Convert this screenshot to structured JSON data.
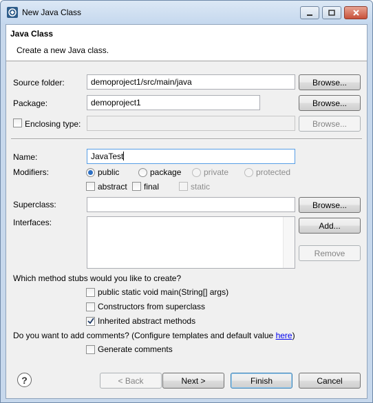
{
  "window": {
    "title": "New Java Class"
  },
  "banner": {
    "title": "Java Class",
    "description": "Create a new Java class."
  },
  "source_folder": {
    "label": "Source folder:",
    "value": "demoproject1/src/main/java",
    "browse": "Browse..."
  },
  "package": {
    "label": "Package:",
    "value": "demoproject1",
    "browse": "Browse..."
  },
  "enclosing": {
    "label": "Enclosing type:",
    "value": "",
    "browse": "Browse..."
  },
  "name": {
    "label": "Name:",
    "value": "JavaTest"
  },
  "modifiers": {
    "label": "Modifiers:",
    "public": "public",
    "package": "package",
    "private": "private",
    "protected": "protected",
    "abstract": "abstract",
    "final": "final",
    "static": "static"
  },
  "superclass": {
    "label": "Superclass:",
    "value": "",
    "browse": "Browse..."
  },
  "interfaces": {
    "label": "Interfaces:",
    "add": "Add...",
    "remove": "Remove"
  },
  "stubs": {
    "question": "Which method stubs would you like to create?",
    "main": "public static void main(String[] args)",
    "constructors": "Constructors from superclass",
    "inherited": "Inherited abstract methods"
  },
  "comments": {
    "question_prefix": "Do you want to add comments? (Configure templates and default value ",
    "link": "here",
    "question_suffix": ")",
    "generate": "Generate comments"
  },
  "footer": {
    "help": "?",
    "back": "< Back",
    "next": "Next >",
    "finish": "Finish",
    "cancel": "Cancel"
  }
}
